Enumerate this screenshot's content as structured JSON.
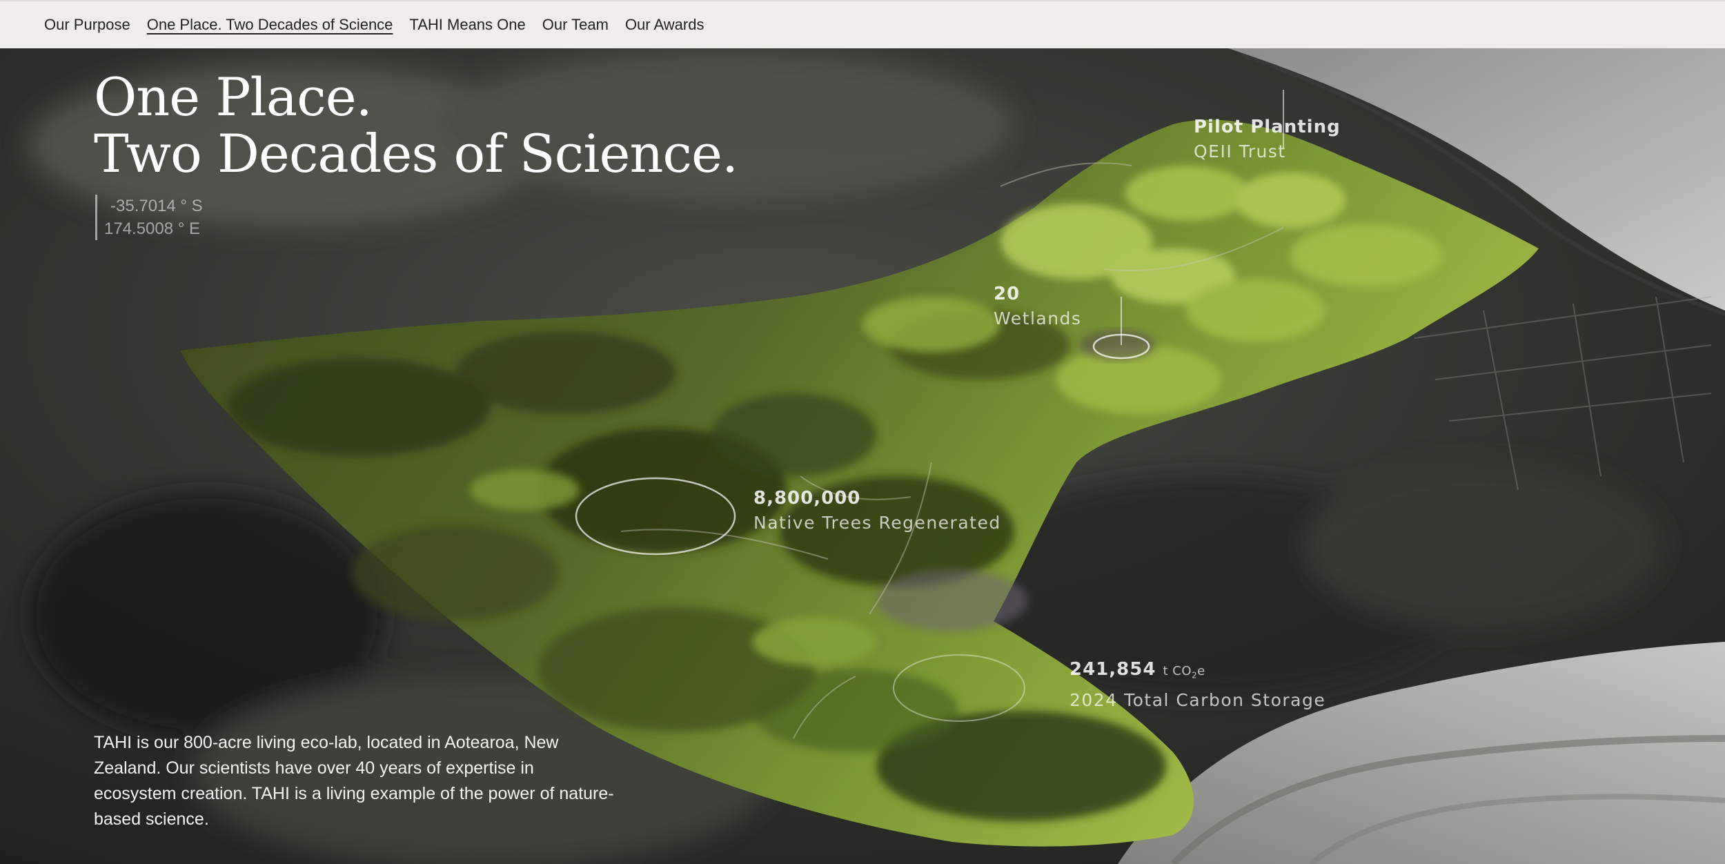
{
  "nav": {
    "items": [
      {
        "label": "Our Purpose",
        "active": false
      },
      {
        "label": "One Place. Two Decades of Science",
        "active": true
      },
      {
        "label": "TAHI Means One",
        "active": false
      },
      {
        "label": "Our Team",
        "active": false
      },
      {
        "label": "Our Awards",
        "active": false
      }
    ]
  },
  "hero": {
    "title_line1": "One Place.",
    "title_line2": "Two Decades of Science.",
    "coords": {
      "lat": "-35.7014 ° S",
      "lon": "174.5008 ° E"
    },
    "intro": "TAHI is our 800-acre living eco-lab, located in Aotearoa, New Zealand. Our scientists have over 40 years of expertise in ecosystem creation. TAHI is a living example of the power of nature-based science."
  },
  "map_labels": {
    "pilot": {
      "title": "Pilot Planting",
      "subtitle": "QEII Trust"
    },
    "wetlands": {
      "number": "20",
      "caption": "Wetlands"
    },
    "trees": {
      "number": "8,800,000",
      "caption": "Native Trees Regenerated"
    },
    "carbon": {
      "number": "241,854",
      "unit_prefix": "t CO",
      "unit_sub": "2",
      "unit_suffix": "e",
      "caption": "2024 Total Carbon Storage"
    }
  },
  "colors": {
    "nav_bg": "#efedea",
    "forest_dark": "#3e4a1c",
    "forest_light": "#a8c24a",
    "terrain_dark": "#1e201c",
    "water_light": "#cfcfcb"
  }
}
